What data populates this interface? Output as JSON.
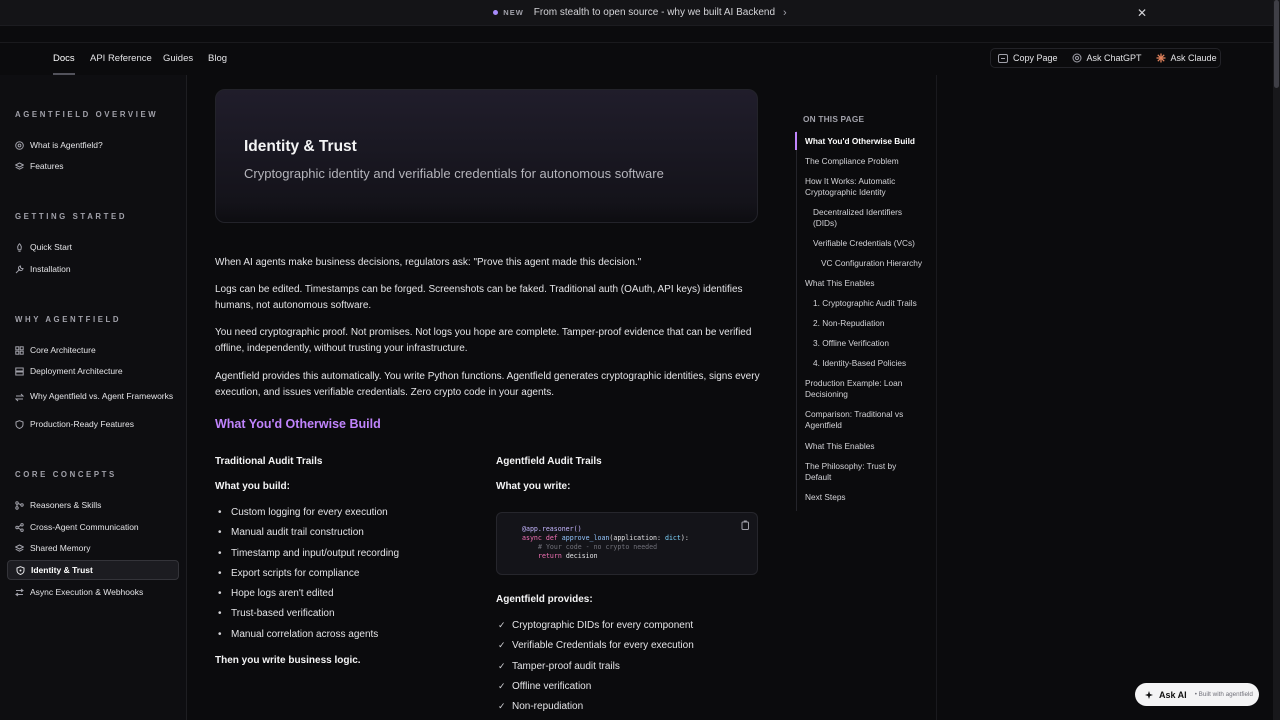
{
  "announcement": {
    "badge": "NEW",
    "text": "From stealth to open source - why we built AI Backend"
  },
  "nav": {
    "tabs": [
      "Docs",
      "API Reference",
      "Guides",
      "Blog"
    ],
    "actions": [
      "Copy Page",
      "Ask ChatGPT",
      "Ask Claude"
    ]
  },
  "sidebar": {
    "sections": [
      {
        "title": "AGENTFIELD OVERVIEW",
        "items": [
          "What is Agentfield?",
          "Features"
        ]
      },
      {
        "title": "GETTING STARTED",
        "items": [
          "Quick Start",
          "Installation"
        ]
      },
      {
        "title": "WHY AGENTFIELD",
        "items": [
          "Core Architecture",
          "Deployment Architecture",
          "Why Agentfield vs. Agent Frameworks",
          "Production-Ready Features"
        ]
      },
      {
        "title": "CORE CONCEPTS",
        "items": [
          "Reasoners & Skills",
          "Cross-Agent Communication",
          "Shared Memory",
          "Identity & Trust",
          "Async Execution & Webhooks"
        ]
      }
    ],
    "active": "Identity & Trust"
  },
  "hero": {
    "title": "Identity & Trust",
    "subtitle": "Cryptographic identity and verifiable credentials for autonomous software"
  },
  "paragraphs": [
    "When AI agents make business decisions, regulators ask: \"Prove this agent made this decision.\"",
    "Logs can be edited. Timestamps can be forged. Screenshots can be faked. Traditional auth (OAuth, API keys) identifies humans, not autonomous software.",
    "You need cryptographic proof. Not promises. Not logs you hope are complete. Tamper-proof evidence that can be verified offline, independently, without trusting your infrastructure.",
    "Agentfield provides this automatically. You write Python functions. Agentfield generates cryptographic identities, signs every execution, and issues verifiable credentials. Zero crypto code in your agents."
  ],
  "section_heading": "What You'd Otherwise Build",
  "left_col": {
    "title": "Traditional Audit Trails",
    "sub": "What you build:",
    "items": [
      "Custom logging for every execution",
      "Manual audit trail construction",
      "Timestamp and input/output recording",
      "Export scripts for compliance",
      "Hope logs aren't edited",
      "Trust-based verification",
      "Manual correlation across agents"
    ],
    "footer": "Then you write business logic."
  },
  "right_col": {
    "title": "Agentfield Audit Trails",
    "sub": "What you write:",
    "code": {
      "decorator": "@app.reasoner()",
      "kw_async": "async",
      "kw_def": "def",
      "fn": "approve_loan",
      "param": "(application: ",
      "type": "dict",
      "close": "):",
      "comment": "# Your code - no crypto needed",
      "kw_return": "return",
      "ret": "decision"
    },
    "provides_title": "Agentfield provides:",
    "provides": [
      "Cryptographic DIDs for every component",
      "Verifiable Credentials for every execution",
      "Tamper-proof audit trails",
      "Offline verification",
      "Non-repudiation"
    ]
  },
  "toc": {
    "title": "ON THIS PAGE",
    "items": [
      "What You'd Otherwise Build",
      "The Compliance Problem",
      "How It Works: Automatic Cryptographic Identity",
      "Decentralized Identifiers (DIDs)",
      "Verifiable Credentials (VCs)",
      "VC Configuration Hierarchy",
      "What This Enables",
      "1. Cryptographic Audit Trails",
      "2. Non-Repudiation",
      "3. Offline Verification",
      "4. Identity-Based Policies",
      "Production Example: Loan Decisioning",
      "Comparison: Traditional vs Agentfield",
      "What This Enables",
      "The Philosophy: Trust by Default",
      "Next Steps"
    ]
  },
  "ask_ai": {
    "label": "Ask AI",
    "built_with": "• Built with agentfield"
  },
  "colors": {
    "accent": "#c084fc",
    "background": "#0b0b0d",
    "sidebar": "#0e0e11"
  }
}
